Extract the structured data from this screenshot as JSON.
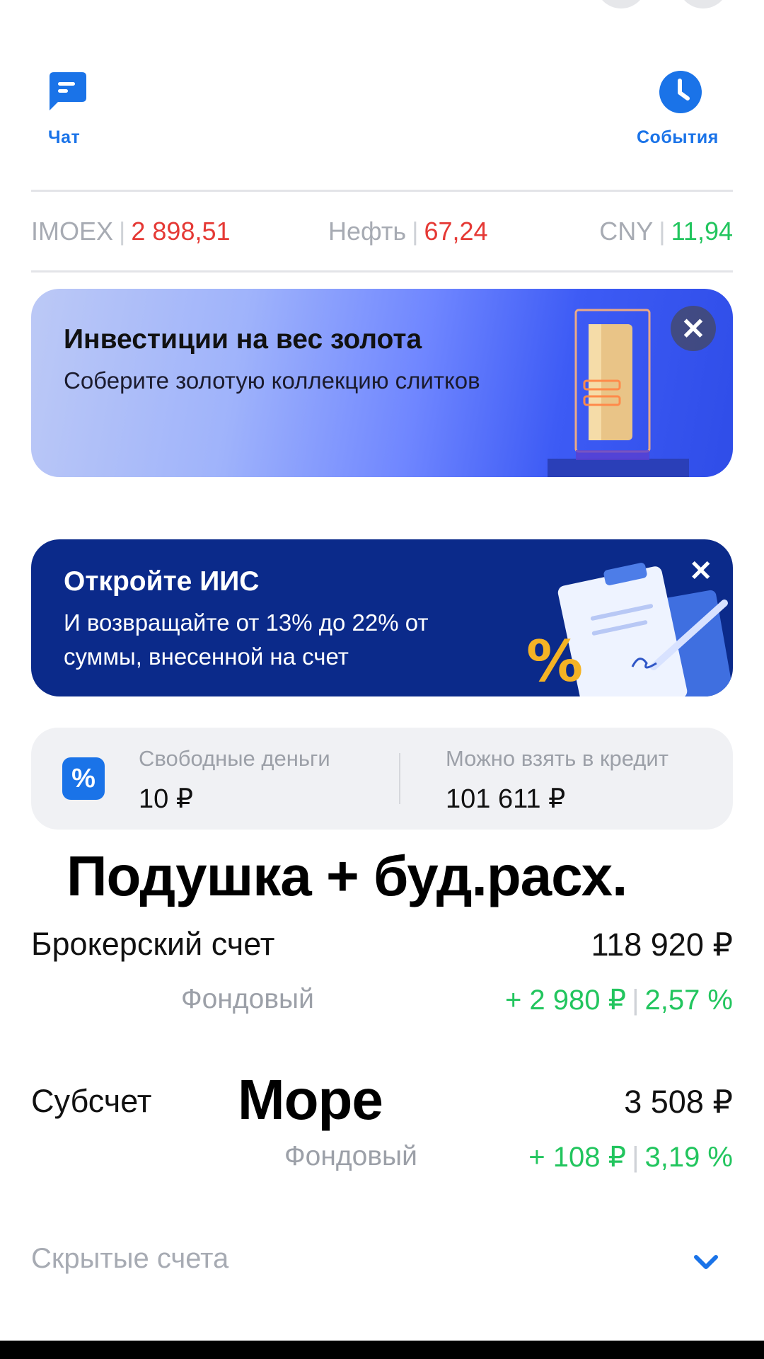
{
  "quick_actions": {
    "chat_label": "Чат",
    "events_label": "События"
  },
  "tickers": [
    {
      "name": "IMOEX",
      "value": "2 898,51",
      "color": "#e53935"
    },
    {
      "name": "Нефть",
      "value": "67,24",
      "color": "#e53935"
    },
    {
      "name": "CNY",
      "value": "11,94",
      "color": "#22c55e"
    }
  ],
  "banners": {
    "gold": {
      "title": "Инвестиции на вес золота",
      "subtitle": "Соберите золотую коллекцию слитков"
    },
    "iis": {
      "title": "Откройте ИИС",
      "subtitle": "И возвращайте от 13% до 22% от суммы, внесенной на счет"
    }
  },
  "money": {
    "free_label": "Свободные деньги",
    "free_value": "10 ₽",
    "credit_label": "Можно взять в кредит",
    "credit_value": "101 611 ₽"
  },
  "overlay_title": "Подушка + буд.расх.",
  "accounts": [
    {
      "name": "Брокерский счет",
      "amount": "118 920 ₽",
      "type": "Фондовый",
      "change_abs": "+ 2 980 ₽",
      "change_pct": "2,57 %"
    },
    {
      "name": "Субсчет",
      "overlay": "Море",
      "amount": "3 508 ₽",
      "type": "Фондовый",
      "change_abs": "+ 108 ₽",
      "change_pct": "3,19 %"
    }
  ],
  "hidden_accounts_label": "Скрытые счета",
  "colors": {
    "accent": "#1a73e8",
    "positive": "#22c55e",
    "negative": "#e53935"
  }
}
